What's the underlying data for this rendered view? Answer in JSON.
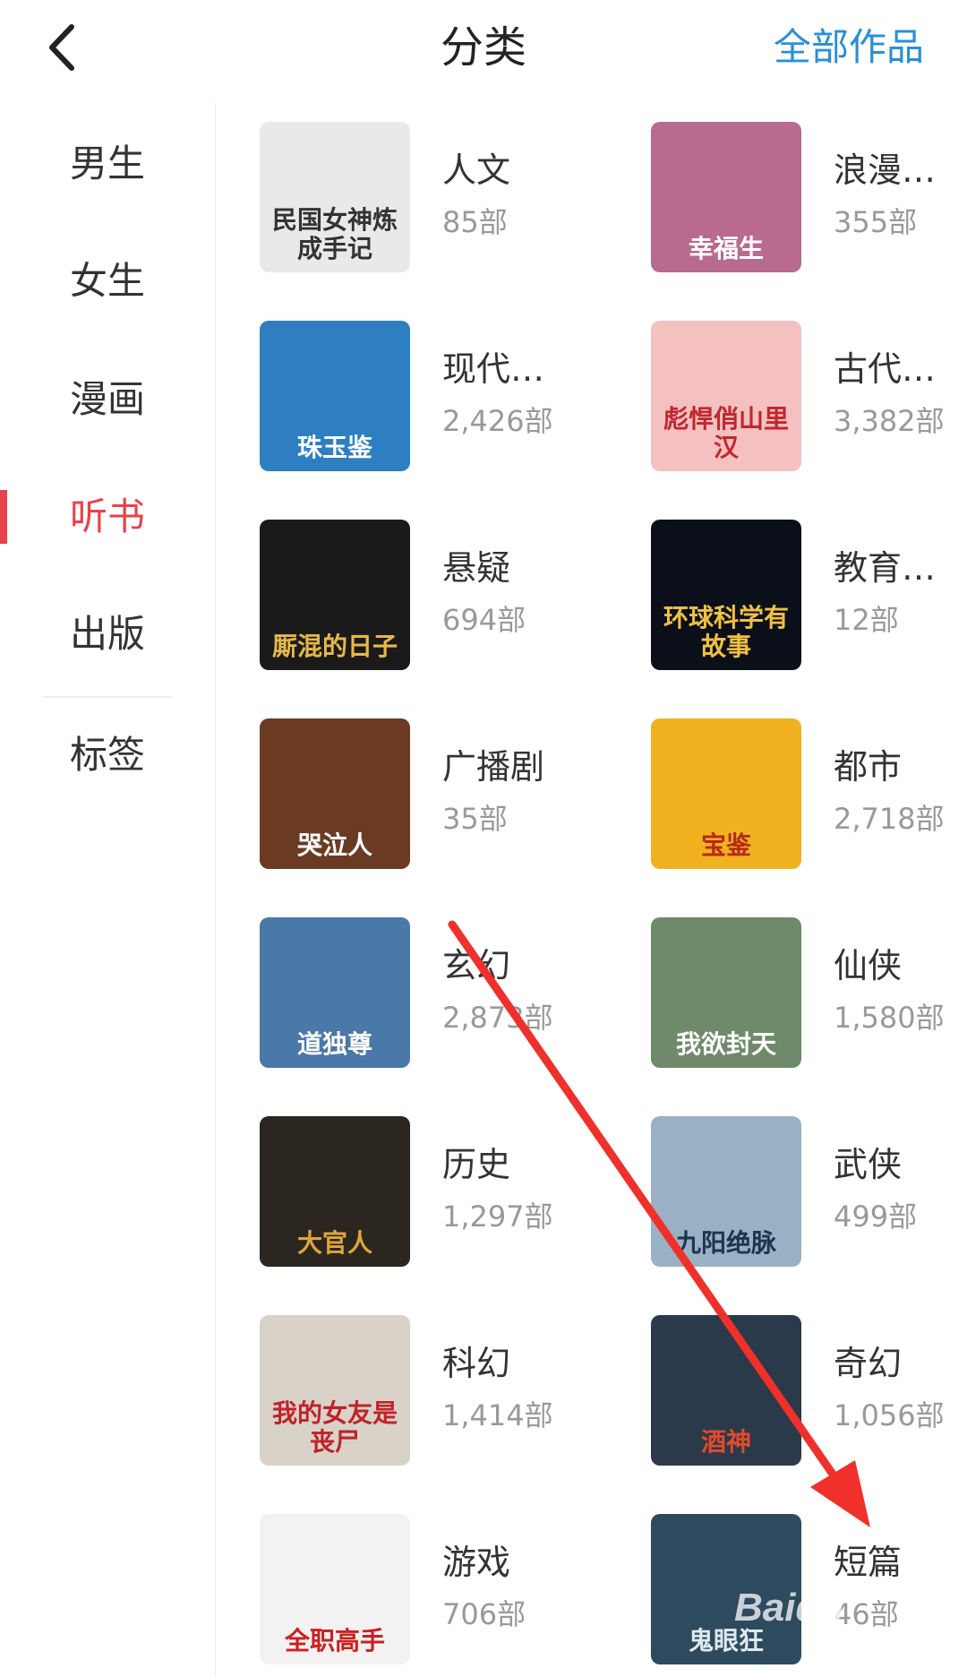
{
  "header": {
    "title": "分类",
    "right_link": "全部作品"
  },
  "sidebar": {
    "items": [
      {
        "label": "男生",
        "active": false
      },
      {
        "label": "女生",
        "active": false
      },
      {
        "label": "漫画",
        "active": false
      },
      {
        "label": "听书",
        "active": true
      },
      {
        "label": "出版",
        "active": false
      },
      {
        "label": "标签",
        "active": false
      }
    ]
  },
  "categories": [
    {
      "name": "人文",
      "count": "85部",
      "cover_text": "民国女神炼成手记",
      "cover_bg": "#e9e9e9",
      "cover_fg": "#333333"
    },
    {
      "name": "浪漫…",
      "count": "355部",
      "cover_text": "幸福生",
      "cover_bg": "#b86a8f",
      "cover_fg": "#ffffff"
    },
    {
      "name": "现代…",
      "count": "2,426部",
      "cover_text": "珠玉鉴",
      "cover_bg": "#2d7fc2",
      "cover_fg": "#ffffff"
    },
    {
      "name": "古代…",
      "count": "3,382部",
      "cover_text": "彪悍俏山里汉",
      "cover_bg": "#f4c0c0",
      "cover_fg": "#c0282e"
    },
    {
      "name": "悬疑",
      "count": "694部",
      "cover_text": "厮混的日子",
      "cover_bg": "#1a1a1a",
      "cover_fg": "#e6b84a"
    },
    {
      "name": "教育…",
      "count": "12部",
      "cover_text": "环球科学有故事",
      "cover_bg": "#0a0f1a",
      "cover_fg": "#f0c040"
    },
    {
      "name": "广播剧",
      "count": "35部",
      "cover_text": "哭泣人",
      "cover_bg": "#6a3b22",
      "cover_fg": "#ffffff"
    },
    {
      "name": "都市",
      "count": "2,718部",
      "cover_text": "宝鉴",
      "cover_bg": "#f0b21e",
      "cover_fg": "#b52a1a"
    },
    {
      "name": "玄幻",
      "count": "2,873部",
      "cover_text": "道独尊",
      "cover_bg": "#4a78a8",
      "cover_fg": "#ffffff"
    },
    {
      "name": "仙侠",
      "count": "1,580部",
      "cover_text": "我欲封天",
      "cover_bg": "#6f8a6a",
      "cover_fg": "#ffffff"
    },
    {
      "name": "历史",
      "count": "1,297部",
      "cover_text": "大官人",
      "cover_bg": "#2b2620",
      "cover_fg": "#e0a43a"
    },
    {
      "name": "武侠",
      "count": "499部",
      "cover_text": "九阳绝脉",
      "cover_bg": "#9ab0c4",
      "cover_fg": "#1e3550"
    },
    {
      "name": "科幻",
      "count": "1,414部",
      "cover_text": "我的女友是丧尸",
      "cover_bg": "#d9d2c8",
      "cover_fg": "#c0222a"
    },
    {
      "name": "奇幻",
      "count": "1,056部",
      "cover_text": "酒神",
      "cover_bg": "#2a3a4a",
      "cover_fg": "#e04a2a"
    },
    {
      "name": "游戏",
      "count": "706部",
      "cover_text": "全职高手",
      "cover_bg": "#f2f2f2",
      "cover_fg": "#cc1f1f"
    },
    {
      "name": "短篇",
      "count": "46部",
      "cover_text": "鬼眼狂",
      "cover_bg": "#2e4a5e",
      "cover_fg": "#dfe9f0"
    }
  ],
  "overlay": {
    "arrow_color": "#f0302a",
    "watermark": "Baidu"
  }
}
